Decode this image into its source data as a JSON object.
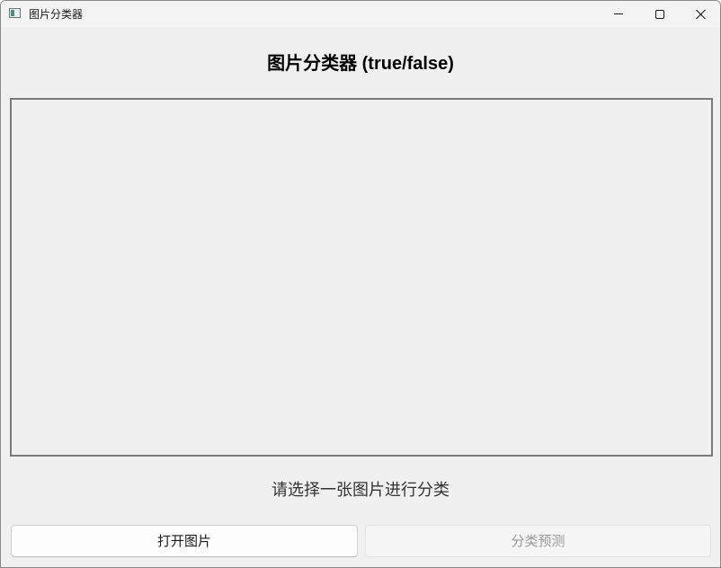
{
  "window": {
    "title": "图片分类器",
    "controls": {
      "minimize_icon": "minimize-icon",
      "maximize_icon": "maximize-icon",
      "close_icon": "close-icon"
    }
  },
  "main": {
    "heading": "图片分类器 (true/false)",
    "status_text": "请选择一张图片进行分类",
    "open_button_label": "打开图片",
    "predict_button_label": "分类预测",
    "predict_button_enabled": false
  }
}
